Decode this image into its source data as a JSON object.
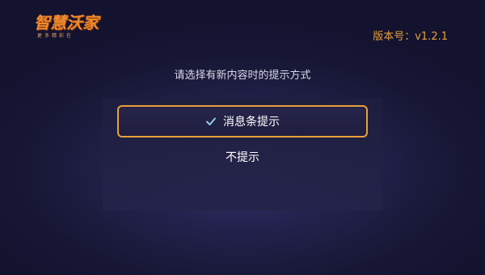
{
  "logo": {
    "title": "智慧沃家",
    "subtitle": "更多精彩在"
  },
  "version": "版本号：v1.2.1",
  "prompt": "请选择有新内容时的提示方式",
  "options": [
    {
      "label": "消息条提示",
      "selected": true,
      "icon": "check-icon"
    },
    {
      "label": "不提示",
      "selected": false
    }
  ],
  "colors": {
    "accent": "#e8a038",
    "check": "#8fd0e8",
    "logo": "#f08a2c"
  }
}
